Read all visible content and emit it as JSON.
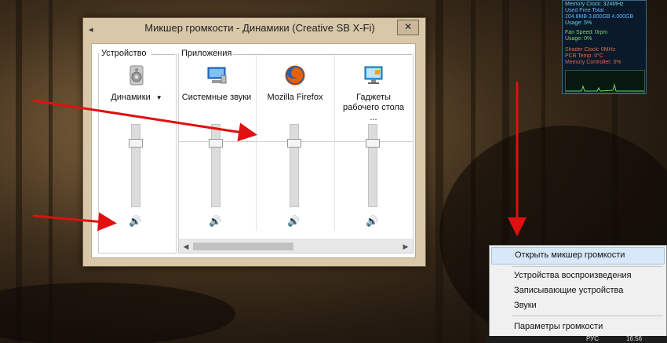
{
  "window": {
    "title": "Микшер громкости - Динамики (Creative SB X-Fi)",
    "close_label": "✕"
  },
  "groups": {
    "device": "Устройство",
    "apps": "Приложения"
  },
  "channels": [
    {
      "label": "Динамики",
      "has_dropdown": true,
      "icon": "speakers-icon",
      "level": 0.8
    },
    {
      "label": "Системные звуки",
      "icon": "system-sounds-icon",
      "level": 0.8
    },
    {
      "label": "Mozilla Firefox",
      "icon": "firefox-icon",
      "level": 0.8
    },
    {
      "label": "Гаджеты рабочего стола ...",
      "icon": "gadgets-icon",
      "level": 0.8
    }
  ],
  "device_dropdown_arrow": "▼",
  "speaker_glyph": "🔊",
  "scroll": {
    "left": "◀",
    "right": "▶"
  },
  "gadget": {
    "rows": [
      "Memory Clock: 324MHz",
      "Used      Free      Total",
      "204.8MB  3.800GB  4.000GB",
      "Usage: 5%",
      "Fan Speed: 0rpm",
      "Usage: 0%",
      "Shader Clock: 0MHz",
      "PCB Temp: 0°C",
      "Memory Controller: 0%"
    ]
  },
  "context_menu": {
    "items": [
      {
        "label": "Открыть микшер громкости",
        "highlighted": true
      },
      {
        "label": "Устройства воспроизведения"
      },
      {
        "label": "Записывающие устройства"
      },
      {
        "label": "Звуки"
      },
      {
        "label": "Параметры громкости"
      }
    ]
  },
  "taskbar": {
    "language": "РУС",
    "time": "16:56"
  },
  "colors": {
    "arrow": "#e01010",
    "accent": "#1d62b5"
  }
}
